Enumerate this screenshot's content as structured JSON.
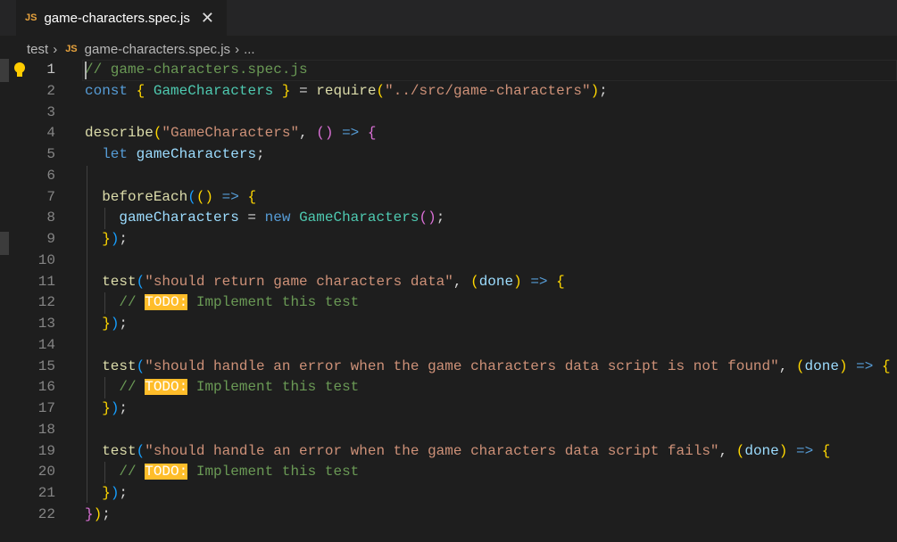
{
  "tab": {
    "label": "game-characters.spec.js",
    "icon_text": "JS"
  },
  "breadcrumb": {
    "folder": "test",
    "file": "game-characters.spec.js",
    "more": "..."
  },
  "colors": {
    "todo_bg": "#ffbd2a",
    "comment": "#6a9955",
    "string": "#ce9178",
    "keyword": "#569cd6"
  },
  "lines": [
    [
      [
        "comment",
        "// game-characters.spec.js"
      ]
    ],
    [
      [
        "kw",
        "const"
      ],
      [
        "p",
        " "
      ],
      [
        "b1",
        "{"
      ],
      [
        "p",
        " "
      ],
      [
        "cls",
        "GameCharacters"
      ],
      [
        "p",
        " "
      ],
      [
        "b1",
        "}"
      ],
      [
        "p",
        " = "
      ],
      [
        "fn",
        "require"
      ],
      [
        "b1",
        "("
      ],
      [
        "str",
        "\"../src/game-characters\""
      ],
      [
        "b1",
        ")"
      ],
      [
        "p",
        ";"
      ]
    ],
    [],
    [
      [
        "fn",
        "describe"
      ],
      [
        "b1",
        "("
      ],
      [
        "str",
        "\"GameCharacters\""
      ],
      [
        "p",
        ", "
      ],
      [
        "b2",
        "()"
      ],
      [
        "p",
        " "
      ],
      [
        "kw",
        "=>"
      ],
      [
        "p",
        " "
      ],
      [
        "b2",
        "{"
      ]
    ],
    [
      [
        "p",
        "  "
      ],
      [
        "kw",
        "let"
      ],
      [
        "p",
        " "
      ],
      [
        "var",
        "gameCharacters"
      ],
      [
        "p",
        ";"
      ]
    ],
    [],
    [
      [
        "p",
        "  "
      ],
      [
        "fn",
        "beforeEach"
      ],
      [
        "b3",
        "("
      ],
      [
        "b1",
        "()"
      ],
      [
        "p",
        " "
      ],
      [
        "kw",
        "=>"
      ],
      [
        "p",
        " "
      ],
      [
        "b1",
        "{"
      ]
    ],
    [
      [
        "p",
        "    "
      ],
      [
        "var",
        "gameCharacters"
      ],
      [
        "p",
        " = "
      ],
      [
        "kw",
        "new"
      ],
      [
        "p",
        " "
      ],
      [
        "cls",
        "GameCharacters"
      ],
      [
        "b2",
        "()"
      ],
      [
        "p",
        ";"
      ]
    ],
    [
      [
        "p",
        "  "
      ],
      [
        "b1",
        "}"
      ],
      [
        "b3",
        ")"
      ],
      [
        "p",
        ";"
      ]
    ],
    [],
    [
      [
        "p",
        "  "
      ],
      [
        "fn",
        "test"
      ],
      [
        "b3",
        "("
      ],
      [
        "str",
        "\"should return game characters data\""
      ],
      [
        "p",
        ", "
      ],
      [
        "b1",
        "("
      ],
      [
        "var",
        "done"
      ],
      [
        "b1",
        ")"
      ],
      [
        "p",
        " "
      ],
      [
        "kw",
        "=>"
      ],
      [
        "p",
        " "
      ],
      [
        "b1",
        "{"
      ]
    ],
    [
      [
        "p",
        "    "
      ],
      [
        "comment",
        "// "
      ],
      [
        "todo",
        "TODO:"
      ],
      [
        "comment",
        " Implement this test"
      ]
    ],
    [
      [
        "p",
        "  "
      ],
      [
        "b1",
        "}"
      ],
      [
        "b3",
        ")"
      ],
      [
        "p",
        ";"
      ]
    ],
    [],
    [
      [
        "p",
        "  "
      ],
      [
        "fn",
        "test"
      ],
      [
        "b3",
        "("
      ],
      [
        "str",
        "\"should handle an error when the game characters data script is not found\""
      ],
      [
        "p",
        ", "
      ],
      [
        "b1",
        "("
      ],
      [
        "var",
        "done"
      ],
      [
        "b1",
        ")"
      ],
      [
        "p",
        " "
      ],
      [
        "kw",
        "=>"
      ],
      [
        "p",
        " "
      ],
      [
        "b1",
        "{"
      ]
    ],
    [
      [
        "p",
        "    "
      ],
      [
        "comment",
        "// "
      ],
      [
        "todo",
        "TODO:"
      ],
      [
        "comment",
        " Implement this test"
      ]
    ],
    [
      [
        "p",
        "  "
      ],
      [
        "b1",
        "}"
      ],
      [
        "b3",
        ")"
      ],
      [
        "p",
        ";"
      ]
    ],
    [],
    [
      [
        "p",
        "  "
      ],
      [
        "fn",
        "test"
      ],
      [
        "b3",
        "("
      ],
      [
        "str",
        "\"should handle an error when the game characters data script fails\""
      ],
      [
        "p",
        ", "
      ],
      [
        "b1",
        "("
      ],
      [
        "var",
        "done"
      ],
      [
        "b1",
        ")"
      ],
      [
        "p",
        " "
      ],
      [
        "kw",
        "=>"
      ],
      [
        "p",
        " "
      ],
      [
        "b1",
        "{"
      ]
    ],
    [
      [
        "p",
        "    "
      ],
      [
        "comment",
        "// "
      ],
      [
        "todo",
        "TODO:"
      ],
      [
        "comment",
        " Implement this test"
      ]
    ],
    [
      [
        "p",
        "  "
      ],
      [
        "b1",
        "}"
      ],
      [
        "b3",
        ")"
      ],
      [
        "p",
        ";"
      ]
    ],
    [
      [
        "b2",
        "}"
      ],
      [
        "b1",
        ")"
      ],
      [
        "p",
        ";"
      ]
    ]
  ]
}
